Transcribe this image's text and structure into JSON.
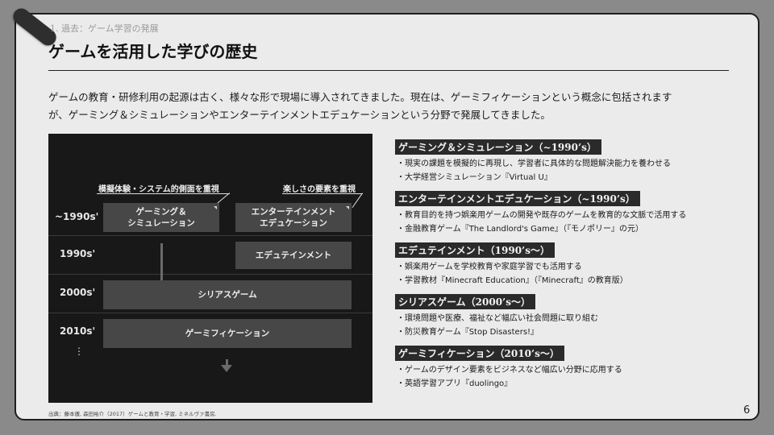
{
  "header": {
    "section": "1. 過去：ゲーム学習の発展",
    "title": "ゲームを活用した学びの歴史"
  },
  "intro": {
    "line1": "ゲームの教育・研修利用の起源は古く、様々な形で現場に導入されてきました。現在は、ゲーミフィケーションという概念に包括されます",
    "line2": "が、ゲーミング＆シミュレーションやエンターテインメントエデュケーションという分野で発展してきました。"
  },
  "diagram": {
    "callouts": [
      "模擬体験・システム的側面を重視",
      "楽しさの要素を重視"
    ],
    "eras": [
      "~1990s'",
      "1990s'",
      "2000s'",
      "2010s'"
    ],
    "dots": "⋮",
    "boxes": {
      "gaming_sim": [
        "ゲーミング＆",
        "シミュレーション"
      ],
      "ent_edu": [
        "エンターテインメント",
        "エデュケーション"
      ],
      "edutainment": "エデュテインメント",
      "serious": "シリアスゲーム",
      "gamification": "ゲーミフィケーション"
    }
  },
  "topics": [
    {
      "heading": "ゲーミング＆シミュレーション（~1990’s）",
      "items": [
        "・現実の課題を模擬的に再現し、学習者に具体的な問題解決能力を養わせる",
        "・大学経営シミュレーション『Virtual U』"
      ]
    },
    {
      "heading": "エンターテインメントエデュケーション（~1990’s）",
      "items": [
        "・教育目的を持つ娯楽用ゲームの開発や既存のゲームを教育的な文脈で活用する",
        "・金融教育ゲーム『The Landlord's Game』（『モノポリー』の元）"
      ]
    },
    {
      "heading": "エデュテインメント（1990’s〜）",
      "items": [
        "・娯楽用ゲームを学校教育や家庭学習でも活用する",
        "・学習教材『Minecraft Education』（『Minecraft』の教育版）"
      ]
    },
    {
      "heading": "シリアスゲーム（2000’s〜）",
      "items": [
        "・環境問題や医療、福祉など幅広い社会問題に取り組む",
        "・防災教育ゲーム『Stop Disasters!』"
      ]
    },
    {
      "heading": "ゲーミフィケーション（2010’s〜）",
      "items": [
        "・ゲームのデザイン要素をビジネスなど幅広い分野に応用する",
        "・英語学習アプリ『duolingo』"
      ]
    }
  ],
  "footer": {
    "source": "出典：藤本徹, 森田裕介（2017）ゲームと教育・学習, ミネルヴァ書房.",
    "page": "6"
  }
}
